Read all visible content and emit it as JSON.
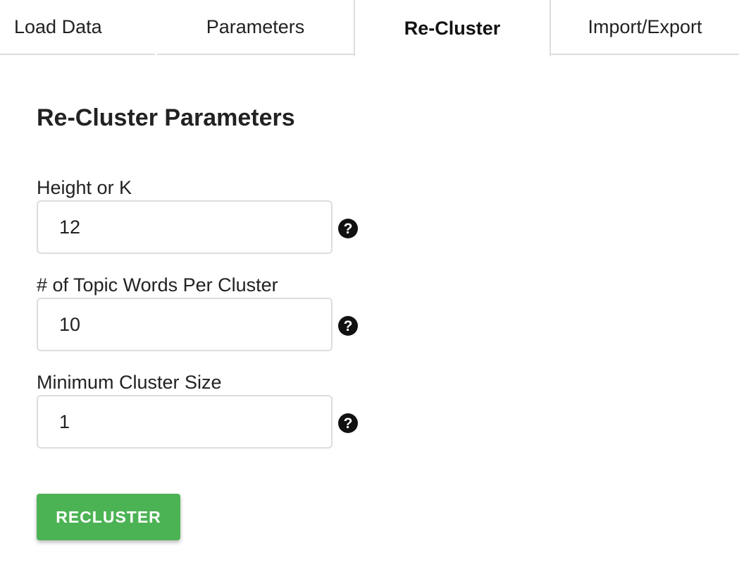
{
  "tabs": [
    {
      "label": "Load Data",
      "active": false
    },
    {
      "label": "Parameters",
      "active": false
    },
    {
      "label": "Re-Cluster",
      "active": true
    },
    {
      "label": "Import/Export",
      "active": false
    }
  ],
  "panel": {
    "title": "Re-Cluster Parameters",
    "fields": [
      {
        "label": "Height or K",
        "value": "12",
        "help_icon": "question-circle-icon"
      },
      {
        "label": "# of Topic Words Per Cluster",
        "value": "10",
        "help_icon": "question-circle-icon"
      },
      {
        "label": "Minimum Cluster Size",
        "value": "1",
        "help_icon": "question-circle-icon"
      }
    ],
    "submit_label": "RECLUSTER"
  },
  "colors": {
    "button_bg": "#4cb354",
    "border": "#dddddd",
    "text": "#222222"
  }
}
